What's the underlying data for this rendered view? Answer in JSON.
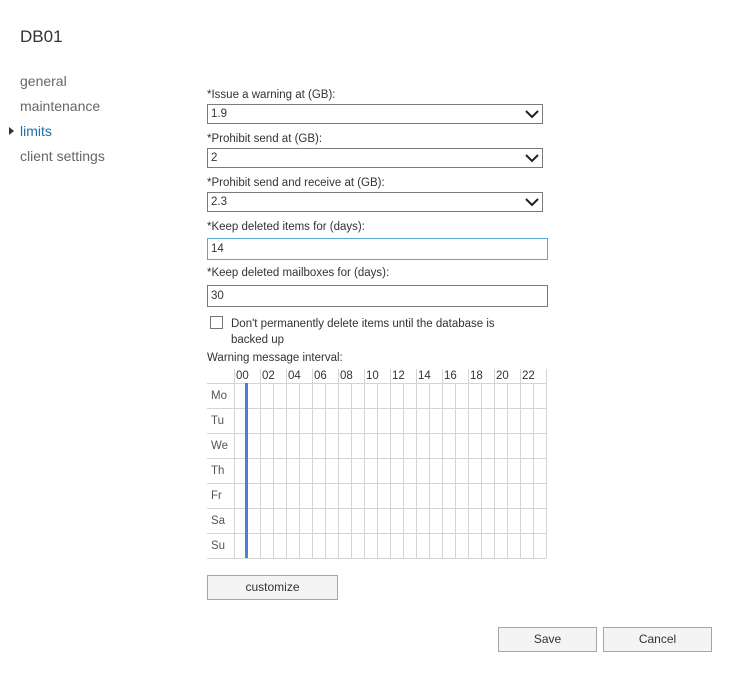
{
  "title": "DB01",
  "nav": {
    "items": [
      {
        "label": "general",
        "active": false
      },
      {
        "label": "maintenance",
        "active": false
      },
      {
        "label": "limits",
        "active": true
      },
      {
        "label": "client settings",
        "active": false
      }
    ]
  },
  "form": {
    "issue_warning": {
      "label": "*Issue a warning at (GB):",
      "value": "1.9"
    },
    "prohibit_send": {
      "label": "*Prohibit send at (GB):",
      "value": "2"
    },
    "prohibit_send_receive": {
      "label": "*Prohibit send and receive at (GB):",
      "value": "2.3"
    },
    "keep_deleted_items": {
      "label": "*Keep deleted items for (days):",
      "value": "14"
    },
    "keep_deleted_mailboxes": {
      "label": "*Keep deleted mailboxes for (days):",
      "value": "30"
    },
    "dont_delete_until_backup": {
      "label": "Don't permanently delete items until the database is backed up",
      "checked": false
    }
  },
  "schedule": {
    "label": "Warning message interval:",
    "hours": [
      "00",
      "02",
      "04",
      "06",
      "08",
      "10",
      "12",
      "14",
      "16",
      "18",
      "20",
      "22"
    ],
    "days": [
      "Mo",
      "Tu",
      "We",
      "Th",
      "Fr",
      "Sa",
      "Su"
    ],
    "selected_hour": 0,
    "accent_color": "#4a7fd4"
  },
  "buttons": {
    "customize": "customize",
    "save": "Save",
    "cancel": "Cancel"
  }
}
